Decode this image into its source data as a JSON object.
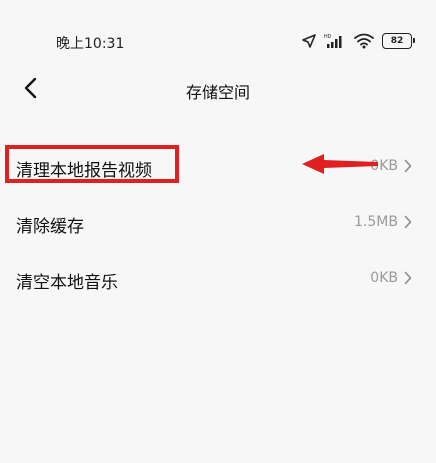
{
  "status_bar": {
    "time": "晚上10:31",
    "icons": [
      "location-arrow-icon",
      "hd-signal-icon",
      "wifi-icon",
      "battery-icon"
    ],
    "battery_level": "82"
  },
  "header": {
    "back_icon": "chevron-left-icon",
    "title": "存储空间"
  },
  "settings": [
    {
      "label": "清理本地报告视频",
      "value": "0KB"
    },
    {
      "label": "清除缓存",
      "value": "1.5MB"
    },
    {
      "label": "清空本地音乐",
      "value": "0KB"
    }
  ],
  "annotation": {
    "highlight_color": "#e02020",
    "arrow_color": "#e02020"
  }
}
